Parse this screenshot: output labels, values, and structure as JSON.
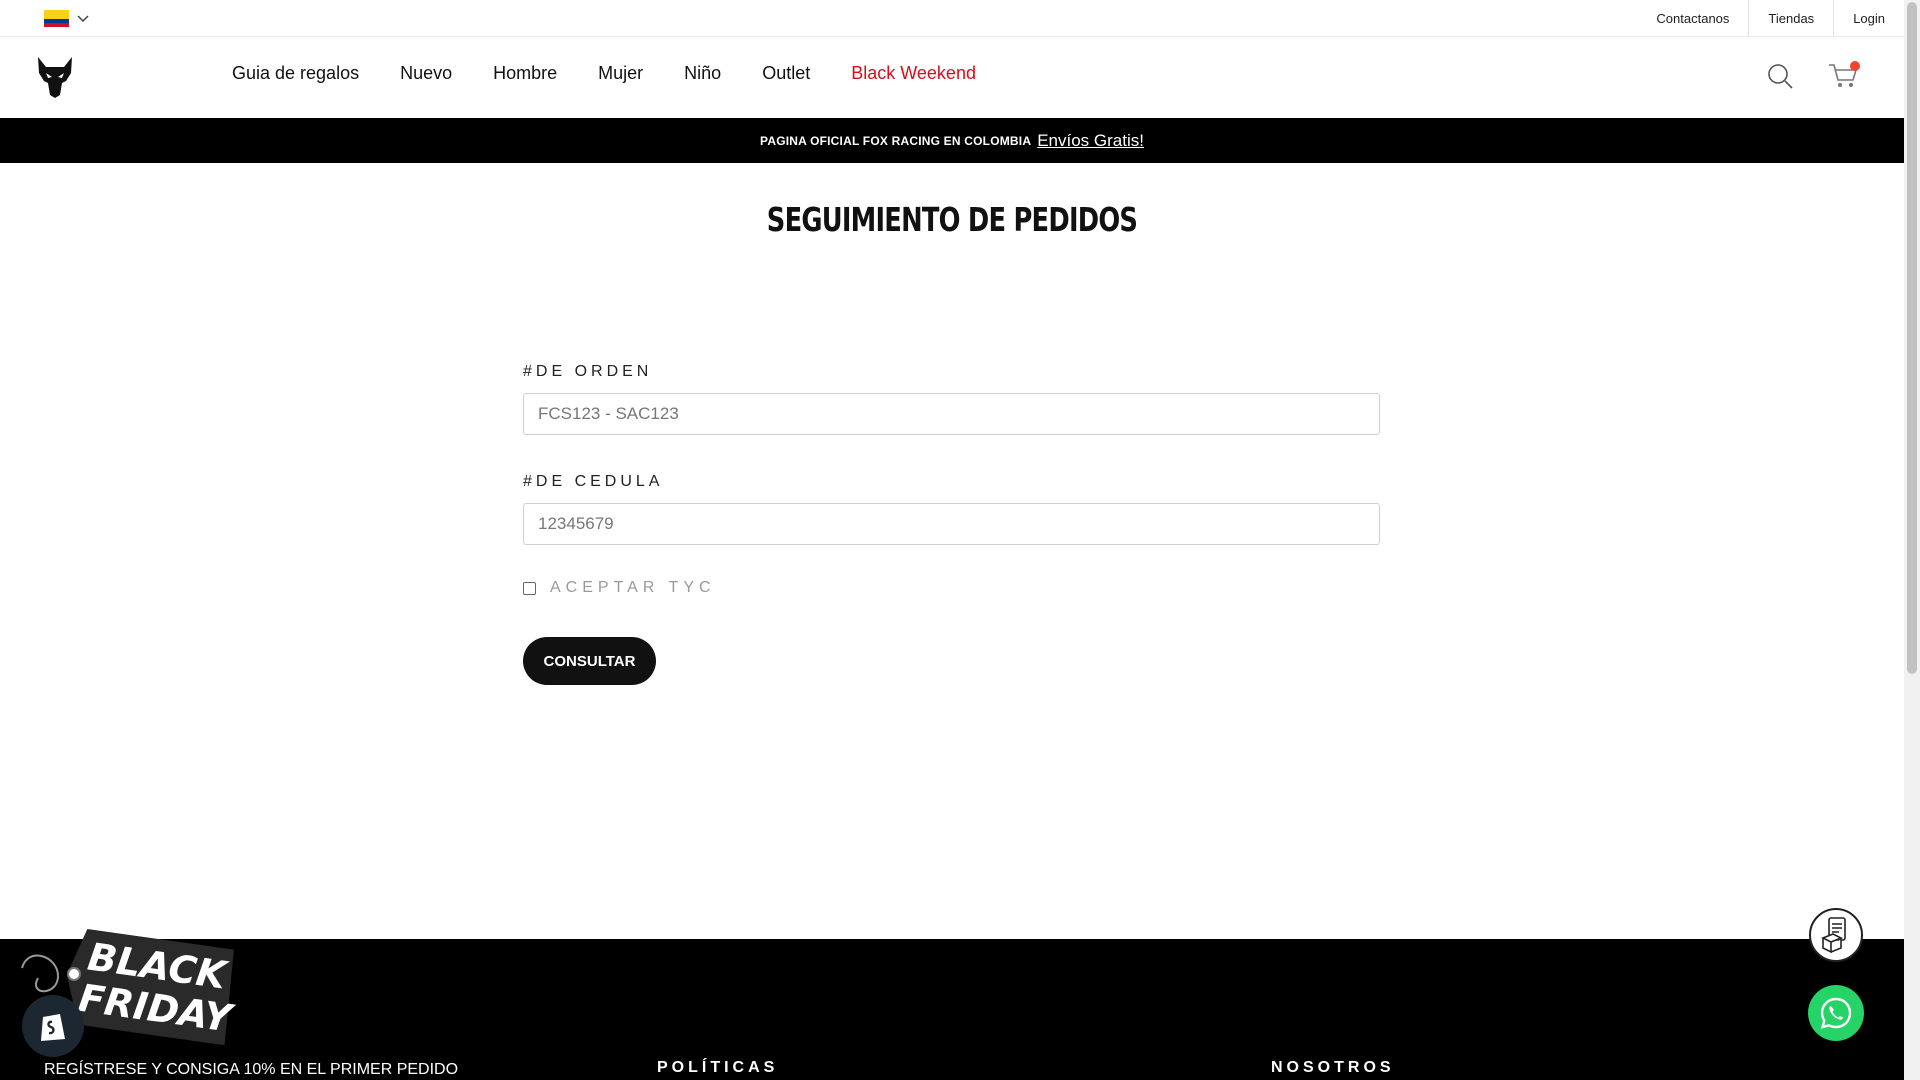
{
  "topbar": {
    "country_icon": "colombia-flag-icon",
    "links": [
      {
        "label": "Contactanos"
      },
      {
        "label": "Tiendas"
      },
      {
        "label": "Login"
      }
    ]
  },
  "nav": {
    "logo_icon": "fox-head-icon",
    "items": [
      {
        "label": "Guia de regalos"
      },
      {
        "label": "Nuevo"
      },
      {
        "label": "Hombre"
      },
      {
        "label": "Mujer"
      },
      {
        "label": "Niño"
      },
      {
        "label": "Outlet"
      },
      {
        "label": "Black Weekend"
      }
    ],
    "accent_color": "#d3101c",
    "search_icon": "search-icon",
    "cart_icon": "cart-icon"
  },
  "promo": {
    "text": "PAGINA OFICIAL FOX RACING EN COLOMBIA",
    "link": "Envíos Gratis!"
  },
  "page": {
    "title": "SEGUIMIENTO DE PEDIDOS"
  },
  "form": {
    "order_label": "#DE ORDEN",
    "order_placeholder": "FCS123 - SAC123",
    "id_label": "#DE CEDULA",
    "id_placeholder": "12345679",
    "terms_label": "ACEPTAR TYC",
    "submit_label": "CONSULTAR"
  },
  "footer": {
    "newsletter": "REGÍSTRESE Y CONSIGA 10% EN EL PRIMER PEDIDO",
    "col_policies": "POLÍTICAS",
    "col_about": "NOSOTROS"
  },
  "badge": {
    "line1": "BLACK",
    "line2": "FRIDAY"
  },
  "floating": {
    "receipt_icon": "receipt-icon",
    "whatsapp_icon": "whatsapp-icon",
    "shopify_icon": "shopify-icon"
  }
}
